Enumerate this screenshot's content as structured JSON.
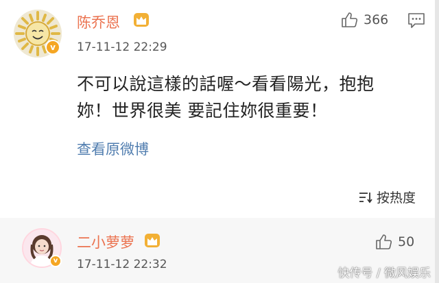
{
  "comments": [
    {
      "user": "陈乔恩",
      "time": "17-11-12 22:29",
      "likes": "366",
      "text_line1": "不可以說這樣的話喔～看看陽光，抱抱",
      "text_line2": "妳！世界很美 要記住妳很重要！",
      "view_original": "查看原微博",
      "verified_icon": "v",
      "avatar_icon": "sun-avatar"
    },
    {
      "user": "二小萝萝",
      "time": "17-11-12 22:32",
      "likes": "50",
      "verified_icon": "v",
      "avatar_icon": "girl-avatar"
    }
  ],
  "sort": {
    "label": "按热度"
  },
  "watermark": "快传号 / 微风娱乐",
  "colors": {
    "username": "#eb7350",
    "link": "#507daf",
    "crown": "#f2b035",
    "alt_background": "#f7f7f7"
  }
}
